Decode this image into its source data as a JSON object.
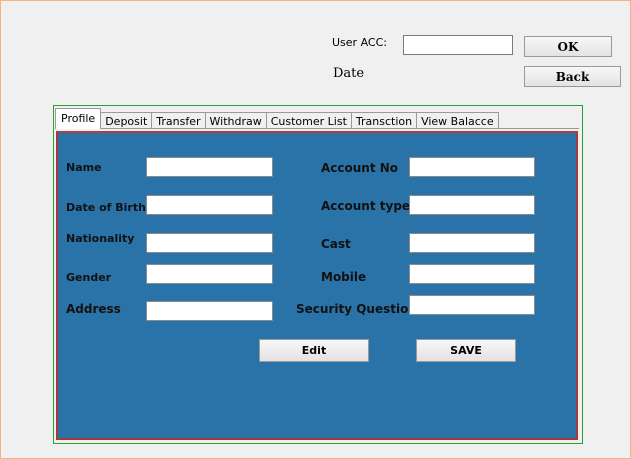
{
  "header": {
    "user_acc_label": "User ACC:",
    "user_acc_value": "",
    "date_label": "Date",
    "ok_label": "OK",
    "back_label": "Back"
  },
  "tabs": [
    {
      "label": "Profile",
      "active": true
    },
    {
      "label": "Deposit",
      "active": false
    },
    {
      "label": "Transfer",
      "active": false
    },
    {
      "label": "Withdraw",
      "active": false
    },
    {
      "label": "Customer List",
      "active": false
    },
    {
      "label": "Transction",
      "active": false
    },
    {
      "label": "View Balacce",
      "active": false
    }
  ],
  "profile": {
    "name_label": "Name",
    "dob_label": "Date of Birth",
    "nationality_label": "Nationality",
    "gender_label": "Gender",
    "address_label": "Address",
    "account_no_label": "Account No",
    "account_type_label": "Account type",
    "cast_label": "Cast",
    "mobile_label": "Mobile",
    "security_question_label": "Security Question",
    "name_value": "",
    "dob_value": "",
    "nationality_value": "",
    "gender_value": "",
    "address_value": "",
    "account_no_value": "",
    "account_type_value": "",
    "cast_value": "",
    "mobile_value": "",
    "security_question_value": "",
    "edit_label": "Edit",
    "save_label": "SAVE"
  },
  "colors": {
    "panel_bg": "#2a73a8",
    "panel_border": "#a33b3b",
    "frame_border": "#2ca02c",
    "window_border": "#f4b183"
  }
}
